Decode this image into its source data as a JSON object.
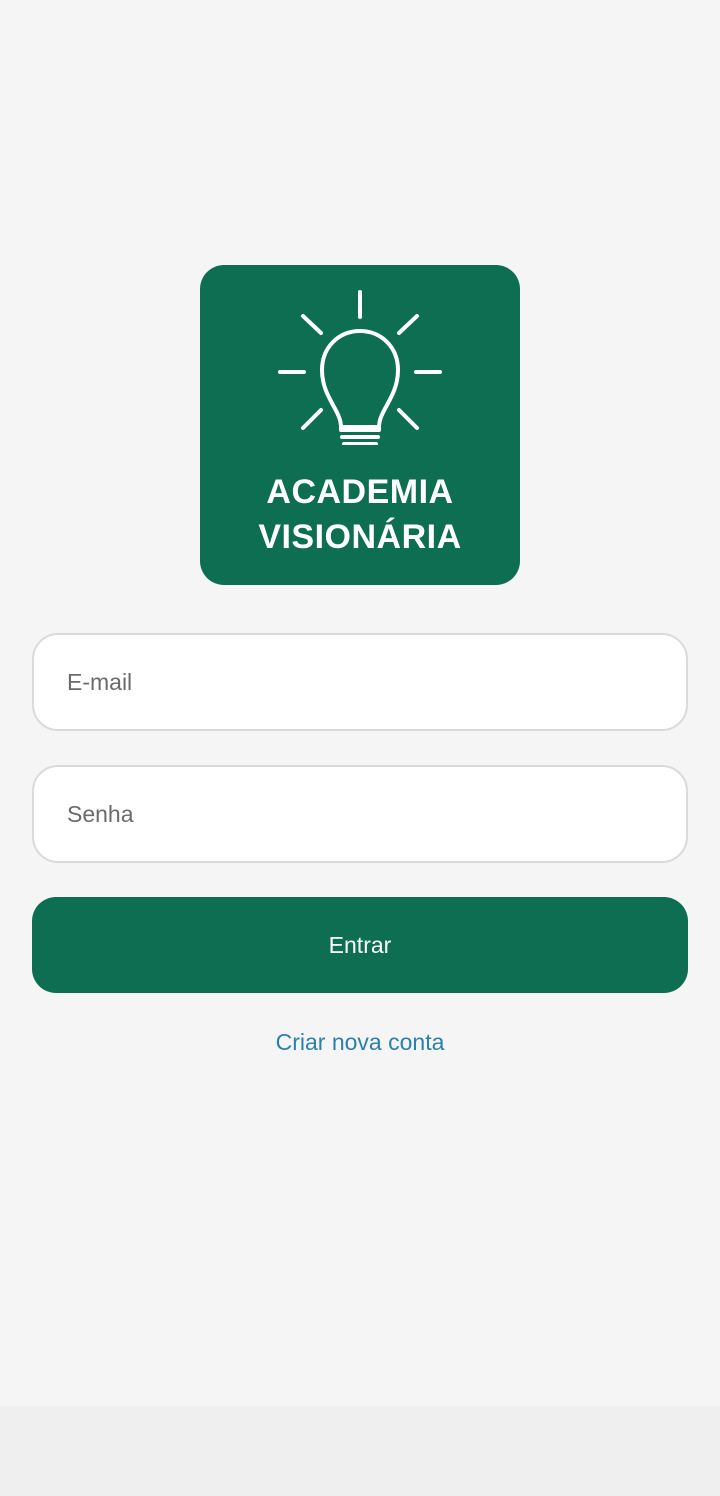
{
  "logo": {
    "icon": "lightbulb-icon",
    "line1": "ACADEMIA",
    "line2": "VISIONÁRIA",
    "background_color": "#0e6e51"
  },
  "form": {
    "email_placeholder": "E-mail",
    "password_placeholder": "Senha",
    "submit_label": "Entrar",
    "create_account_label": "Criar nova conta"
  },
  "colors": {
    "accent": "#0e6e51",
    "link": "#2b80ad",
    "background": "#f5f5f5"
  }
}
